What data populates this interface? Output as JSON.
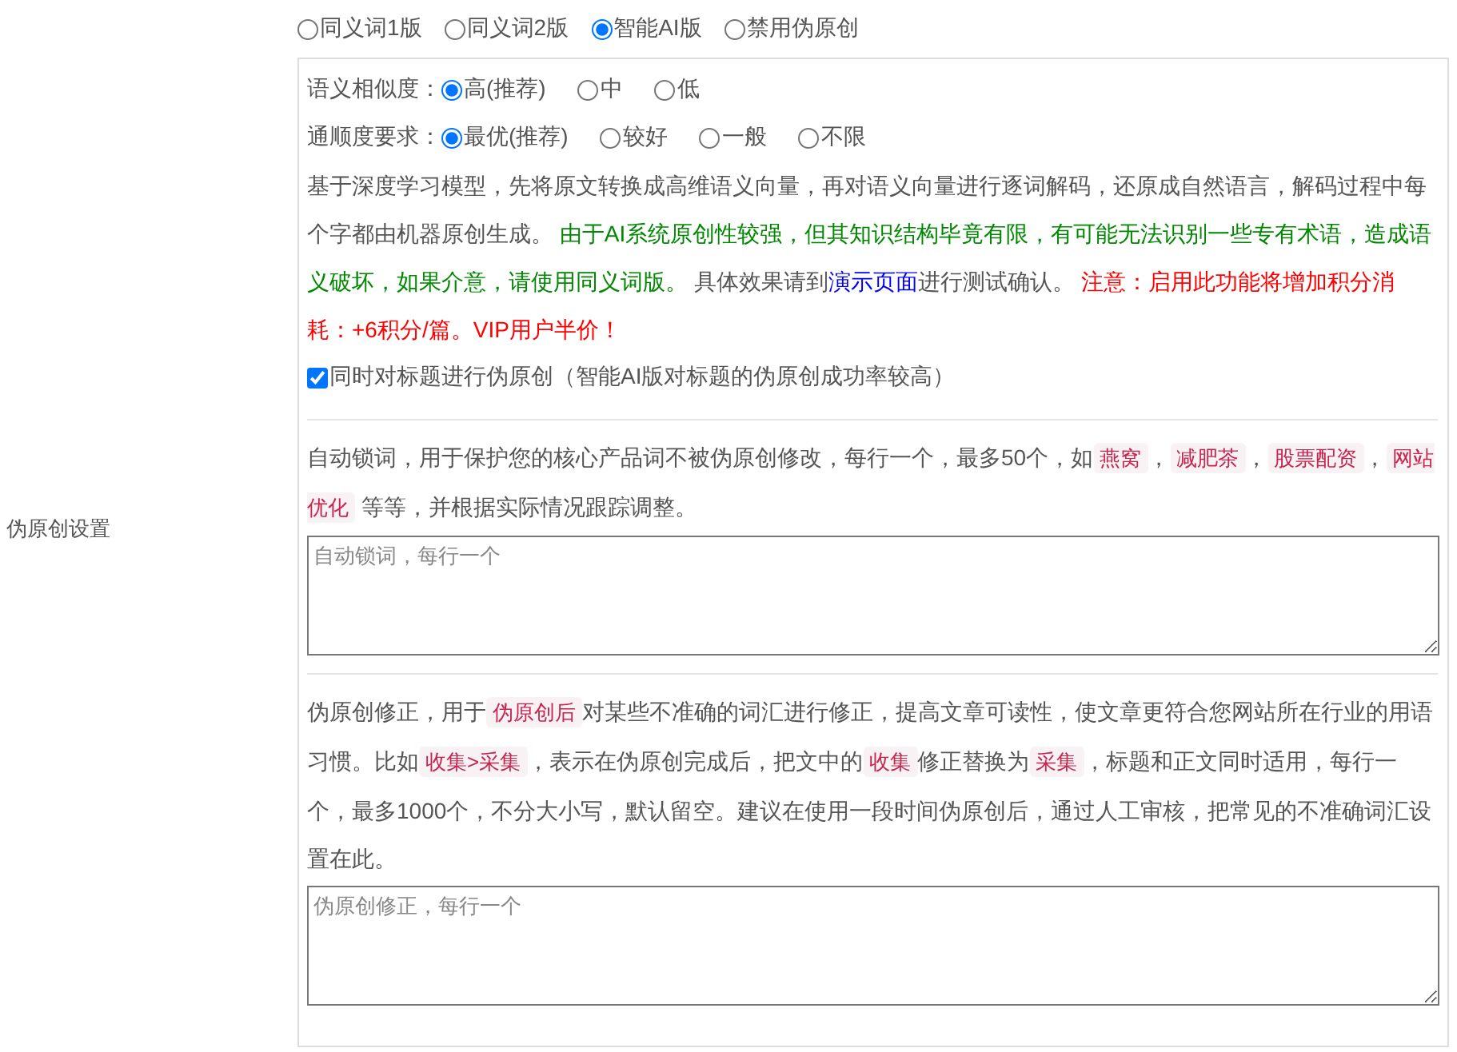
{
  "section_label": "伪原创设置",
  "version_options": [
    {
      "label": "同义词1版",
      "selected": false
    },
    {
      "label": "同义词2版",
      "selected": false
    },
    {
      "label": "智能AI版",
      "selected": true
    },
    {
      "label": "禁用伪原创",
      "selected": false
    }
  ],
  "similarity": {
    "label": "语义相似度：",
    "options": [
      {
        "label": "高(推荐)",
        "selected": true
      },
      {
        "label": "中",
        "selected": false
      },
      {
        "label": "低",
        "selected": false
      }
    ]
  },
  "fluency": {
    "label": "通顺度要求：",
    "options": [
      {
        "label": "最优(推荐)",
        "selected": true
      },
      {
        "label": "较好",
        "selected": false
      },
      {
        "label": "一般",
        "selected": false
      },
      {
        "label": "不限",
        "selected": false
      }
    ]
  },
  "description": [
    {
      "kind": "text",
      "text": "基于深度学习模型，先将原文转换成高维语义向量，再对语义向量进行逐词解码，还原成自然语言，解码过程中每个字都由机器原创生成。 "
    },
    {
      "kind": "green",
      "text": "由于AI系统原创性较强，但其知识结构毕竟有限，有可能无法识别一些专有术语，造成语义破坏，如果介意，请使用同义词版。"
    },
    {
      "kind": "text",
      "text": " 具体效果请到"
    },
    {
      "kind": "link",
      "text": "演示页面"
    },
    {
      "kind": "text",
      "text": "进行测试确认。 "
    },
    {
      "kind": "red",
      "text": "注意：启用此功能将增加积分消耗：+6积分/篇。VIP用户半价！"
    }
  ],
  "title_option": {
    "label": "同时对标题进行伪原创（智能AI版对标题的伪原创成功率较高）",
    "checked": true
  },
  "lock_words": {
    "help": [
      {
        "kind": "text",
        "text": "自动锁词，用于保护您的核心产品词不被伪原创修改，每行一个，最多50个，如"
      },
      {
        "kind": "tag",
        "text": "燕窝"
      },
      {
        "kind": "text",
        "text": "，"
      },
      {
        "kind": "tag",
        "text": "减肥茶"
      },
      {
        "kind": "text",
        "text": "，"
      },
      {
        "kind": "tag",
        "text": "股票配资"
      },
      {
        "kind": "text",
        "text": "，"
      },
      {
        "kind": "tag",
        "text": "网站优化"
      },
      {
        "kind": "text",
        "text": " 等等，并根据实际情况跟踪调整。"
      }
    ],
    "placeholder": "自动锁词，每行一个"
  },
  "corrections": {
    "help": [
      {
        "kind": "text",
        "text": "伪原创修正，用于"
      },
      {
        "kind": "tag",
        "text": "伪原创后"
      },
      {
        "kind": "text",
        "text": "对某些不准确的词汇进行修正，提高文章可读性，使文章更符合您网站所在行业的用语习惯。比如"
      },
      {
        "kind": "tag",
        "text": "收集>采集"
      },
      {
        "kind": "text",
        "text": "，表示在伪原创完成后，把文中的"
      },
      {
        "kind": "tag",
        "text": "收集"
      },
      {
        "kind": "text",
        "text": "修正替换为"
      },
      {
        "kind": "tag",
        "text": "采集"
      },
      {
        "kind": "text",
        "text": "，标题和正文同时适用，每行一个，最多1000个，不分大小写，默认留空。建议在使用一段时间伪原创后，通过人工审核，把常见的不准确词汇设置在此。"
      }
    ],
    "placeholder": "伪原创修正，每行一个"
  }
}
